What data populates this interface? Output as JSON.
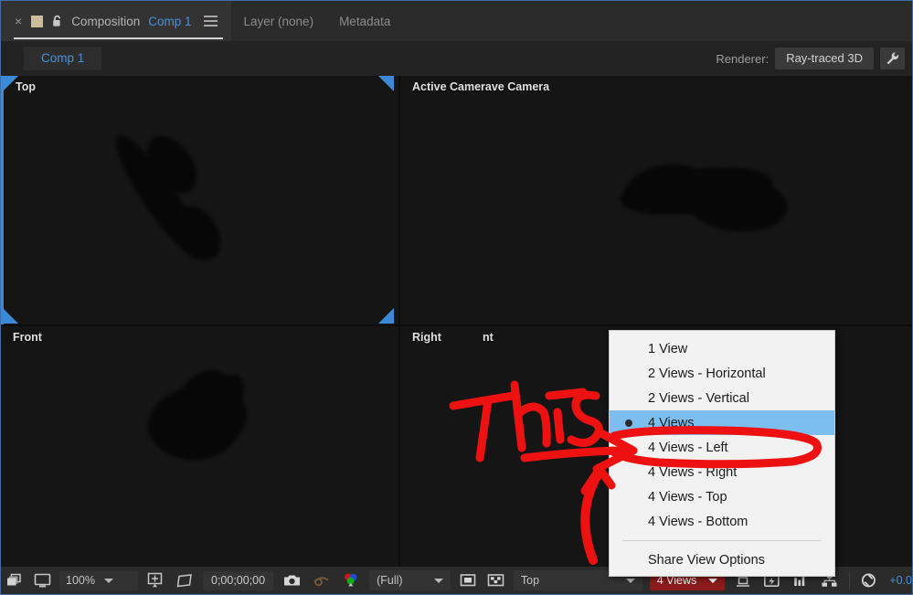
{
  "window": {
    "accent_blue": "#4a8fe0",
    "annotation_red": "#ee1111",
    "highlight_blue": "#7dbef0"
  },
  "tabbar": {
    "close_label": "×",
    "swatch_icon": "composition-swatch-icon",
    "lock_icon": "lock-icon",
    "title_static": "Composition",
    "title_accent": "Comp 1",
    "menu_icon": "panel-menu-icon",
    "layer_tab": "Layer (none)",
    "metadata_tab": "Metadata"
  },
  "subbar": {
    "comp_chip": "Comp 1",
    "renderer_label": "Renderer:",
    "renderer_value": "Ray-traced 3D",
    "renderer_settings_icon": "wrench-icon"
  },
  "viewports": [
    {
      "name": "top",
      "title": "Top",
      "active": true
    },
    {
      "name": "active-camera",
      "title": "Active Camerave Camera",
      "ghost": "",
      "active": false
    },
    {
      "name": "front",
      "title": "Front",
      "active": false
    },
    {
      "name": "right",
      "title": "Right",
      "ghost": "nt",
      "active": false
    }
  ],
  "context_menu": {
    "items": [
      {
        "label": "1 View",
        "selected": false
      },
      {
        "label": "2 Views - Horizontal",
        "selected": false
      },
      {
        "label": "2 Views - Vertical",
        "selected": false
      },
      {
        "label": "4 Views",
        "selected": true
      },
      {
        "label": "4 Views - Left",
        "selected": false
      },
      {
        "label": "4 Views - Right",
        "selected": false
      },
      {
        "label": "4 Views - Top",
        "selected": false
      },
      {
        "label": "4 Views - Bottom",
        "selected": false
      }
    ],
    "footer_item": "Share View Options"
  },
  "annotation": {
    "text": "This",
    "color": "#ee1111",
    "circled_item": "4 Views - Left"
  },
  "bottombar": {
    "always_preview_icon": "always-preview-this-view-icon",
    "main_view_icon": "main-view-monitor-icon",
    "zoom_value": "100%",
    "grid_icon": "grid-guides-icon",
    "mask_icon": "region-of-interest-icon",
    "timecode": "0;00;00;00",
    "snapshot_icon": "camera-snapshot-icon",
    "show_snapshot_icon": "show-snapshot-icon",
    "channels_icon": "show-channel-icon",
    "resolution_value": "(Full)",
    "region_icon": "region-of-interest-box-icon",
    "transparency_icon": "transparency-grid-icon",
    "camera_view_value": "Top",
    "views_value": "4 Views",
    "pixel_aspect_icon": "pixel-aspect-correction-icon",
    "fast_preview_icon": "fast-previews-icon",
    "timeline_icon": "timeline-icon",
    "comp_flowchart_icon": "comp-flowchart-icon",
    "reset_exposure_icon": "reset-exposure-icon",
    "exposure_value": "+0.0"
  }
}
